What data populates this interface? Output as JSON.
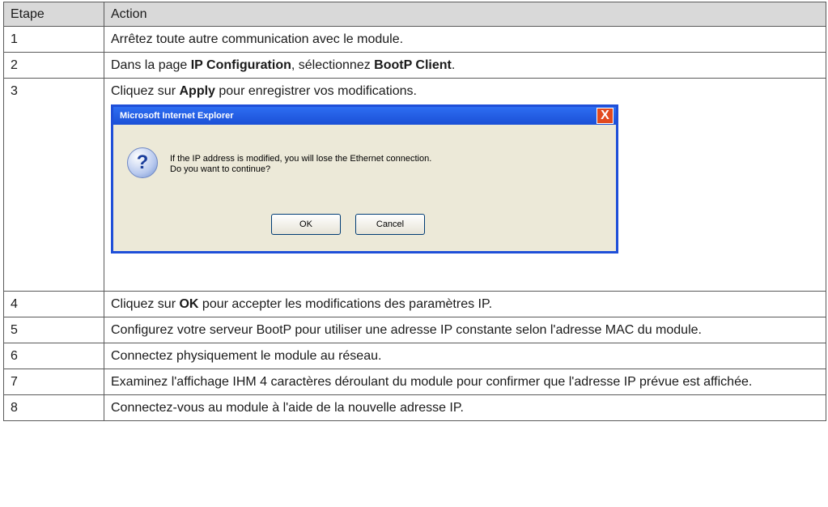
{
  "table": {
    "headers": {
      "step": "Etape",
      "action": "Action"
    },
    "rows": [
      {
        "step": "1",
        "parts": [
          "Arrêtez toute autre communication avec le module."
        ]
      },
      {
        "step": "2",
        "parts": [
          "Dans la page ",
          "IP Configuration",
          ", sélectionnez ",
          "BootP Client",
          "."
        ]
      },
      {
        "step": "3",
        "parts": [
          "Cliquez sur ",
          "Apply",
          " pour enregistrer vos modifications."
        ]
      },
      {
        "step": "4",
        "parts": [
          "Cliquez sur ",
          "OK",
          " pour accepter les modifications des paramètres IP."
        ]
      },
      {
        "step": "5",
        "parts": [
          "Configurez votre serveur BootP pour utiliser une adresse IP constante selon l'adresse MAC du module."
        ]
      },
      {
        "step": "6",
        "parts": [
          "Connectez physiquement le module au réseau."
        ]
      },
      {
        "step": "7",
        "parts": [
          "Examinez l'affichage IHM 4 caractères déroulant du module pour confirmer que l'adresse IP prévue est affichée."
        ]
      },
      {
        "step": "8",
        "parts": [
          "Connectez-vous au module à l'aide de la nouvelle adresse IP."
        ]
      }
    ]
  },
  "dialog": {
    "title": "Microsoft Internet Explorer",
    "close_label": "X",
    "icon": "question-icon",
    "message_line1": "If the IP address is modified, you will lose the Ethernet connection.",
    "message_line2": "Do you want to continue?",
    "ok_label": "OK",
    "cancel_label": "Cancel"
  }
}
